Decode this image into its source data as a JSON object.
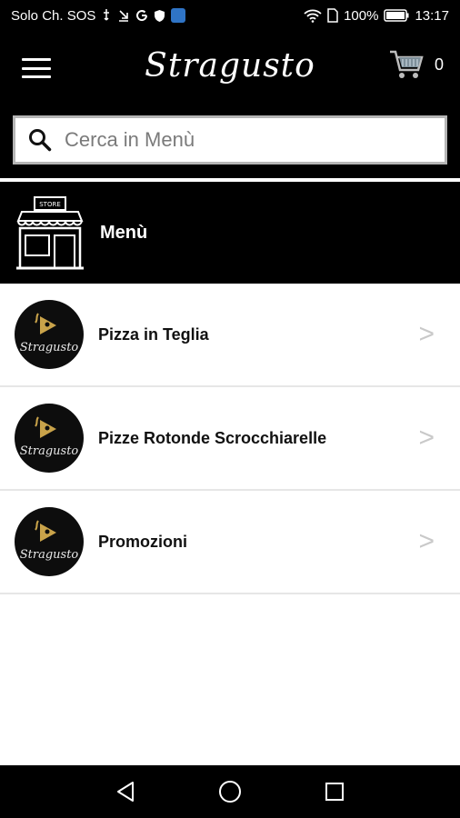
{
  "status_bar": {
    "carrier": "Solo Ch. SOS",
    "battery": "100%",
    "time": "13:17"
  },
  "header": {
    "brand": "Stragusto",
    "cart_count": "0"
  },
  "search": {
    "placeholder": "Cerca in Menù"
  },
  "section": {
    "title": "Menù",
    "store_sign": "STORE"
  },
  "categories": [
    {
      "label": "Pizza in Teglia"
    },
    {
      "label": "Pizze Rotonde Scrocchiarelle"
    },
    {
      "label": "Promozioni"
    }
  ],
  "logo_text": "Stragusto",
  "chevron": ">",
  "colors": {
    "header_bg": "#000000",
    "logo_gold": "#c9a34a",
    "chevron": "#c9c9c9"
  }
}
